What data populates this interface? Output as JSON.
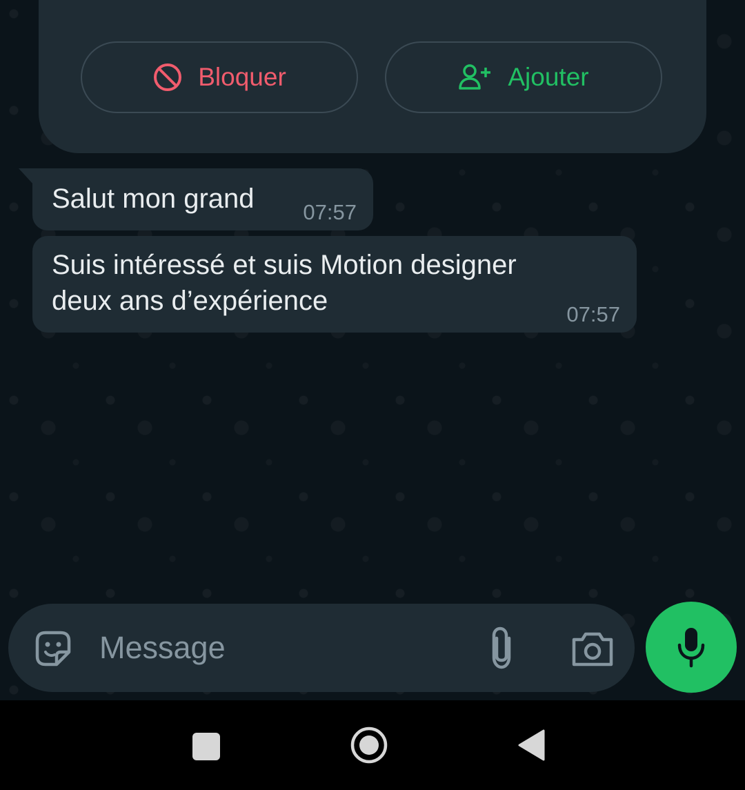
{
  "contact_card": {
    "block_label": "Bloquer",
    "add_label": "Ajouter",
    "block_color": "#f15c6d",
    "add_color": "#21c063",
    "block_icon": "block-icon",
    "add_icon": "add-contact-icon"
  },
  "messages": [
    {
      "text": "Salut mon grand",
      "time": "07:57"
    },
    {
      "text": "Suis intéressé et suis Motion designer\ndeux ans d’expérience",
      "time": "07:57"
    }
  ],
  "composer": {
    "placeholder": "Message",
    "emoji_icon": "sticker-icon",
    "attach_icon": "paperclip-icon",
    "camera_icon": "camera-icon",
    "mic_icon": "mic-icon",
    "accent": "#21c063"
  },
  "nav": {
    "recent_icon": "square-icon",
    "home_icon": "circle-icon",
    "back_icon": "triangle-back-icon"
  }
}
